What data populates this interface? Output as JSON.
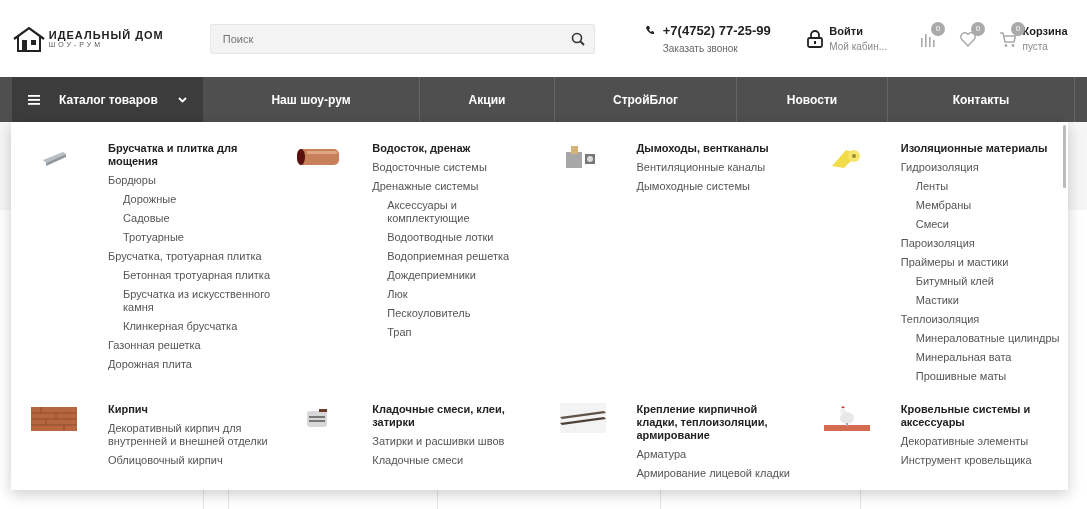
{
  "header": {
    "logo": {
      "title": "ИДЕАЛЬНЫЙ ДОМ",
      "subtitle": "ШОУ-РУМ"
    },
    "search": {
      "placeholder": "Поиск"
    },
    "phone": {
      "number": "+7(4752) 77-25-99",
      "callback": "Заказать звонок"
    },
    "account": {
      "title": "Войти",
      "subtitle": "Мой кабин..."
    },
    "compare": {
      "count": "0"
    },
    "favorites": {
      "count": "0"
    },
    "cart": {
      "count": "0",
      "title": "Корзина",
      "subtitle": "пуста"
    }
  },
  "nav": {
    "catalog": {
      "label": "Каталог товаров",
      "expanded": true
    },
    "items": [
      {
        "label": "Наш шоу-рум"
      },
      {
        "label": "Акции"
      },
      {
        "label": "СтройБлог"
      },
      {
        "label": "Новости"
      },
      {
        "label": "Контакты"
      }
    ]
  },
  "catalog_menu": {
    "sections": [
      {
        "title": "Брусчатка и плитка для мощения",
        "image": {
          "kind": "picture"
        },
        "items": [
          {
            "label": "Бордюры",
            "children": [
              {
                "label": "Дорожные"
              },
              {
                "label": "Садовые"
              },
              {
                "label": "Тротуарные"
              }
            ]
          },
          {
            "label": "Брусчатка, тротуарная плитка",
            "children": [
              {
                "label": "Бетонная тротуарная плитка"
              },
              {
                "label": "Брусчатка из искусственного камня"
              },
              {
                "label": "Клинкерная брусчатка"
              }
            ]
          },
          {
            "label": "Газонная решетка"
          },
          {
            "label": "Дорожная плита"
          }
        ]
      },
      {
        "title": "Водосток, дренаж",
        "image": {
          "kind": "picture"
        },
        "items": [
          {
            "label": "Водосточные системы"
          },
          {
            "label": "Дренажные системы",
            "children": [
              {
                "label": "Аксессуары и комплектующие"
              },
              {
                "label": "Водоотводные лотки"
              },
              {
                "label": "Водоприемная решетка"
              },
              {
                "label": "Дождеприемники"
              },
              {
                "label": "Люк"
              },
              {
                "label": "Пескоуловитель"
              },
              {
                "label": "Трап"
              }
            ]
          }
        ]
      },
      {
        "title": "Дымоходы, вентканалы",
        "image": {
          "kind": "picture"
        },
        "items": [
          {
            "label": "Вентиляционные каналы"
          },
          {
            "label": "Дымоходные системы"
          }
        ]
      },
      {
        "title": "Изоляционные материалы",
        "image": {
          "kind": "picture"
        },
        "items": [
          {
            "label": "Гидроизоляция",
            "children": [
              {
                "label": "Ленты"
              },
              {
                "label": "Мембраны"
              },
              {
                "label": "Смеси"
              }
            ]
          },
          {
            "label": "Пароизоляция"
          },
          {
            "label": "Праймеры и мастики",
            "children": [
              {
                "label": "Битумный клей"
              },
              {
                "label": "Мастики"
              }
            ]
          },
          {
            "label": "Теплоизоляция",
            "children": [
              {
                "label": "Минераловатные цилиндры"
              },
              {
                "label": "Минеральная вата"
              },
              {
                "label": "Прошивные маты"
              }
            ]
          }
        ]
      },
      {
        "title": "Кирпич",
        "image": {
          "kind": "picture"
        },
        "items": [
          {
            "label": "Декоративный кирпич для внутренней и внешней отделки"
          },
          {
            "label": "Облицовочный кирпич"
          }
        ]
      },
      {
        "title": "Кладочные смеси, клеи, затирки",
        "image": {
          "kind": "picture"
        },
        "items": [
          {
            "label": "Затирки и расшивки швов"
          },
          {
            "label": "Кладочные смеси"
          }
        ]
      },
      {
        "title": "Крепление кирпичной кладки, теплоизоляции, армирование",
        "image": {
          "kind": "picture"
        },
        "items": [
          {
            "label": "Арматура"
          },
          {
            "label": "Армирование лицевой кладки"
          }
        ]
      },
      {
        "title": "Кровельные системы и аксессуары",
        "image": {
          "kind": "picture"
        },
        "items": [
          {
            "label": "Декоративные элементы"
          },
          {
            "label": "Инструмент кровельщика"
          }
        ]
      }
    ]
  }
}
